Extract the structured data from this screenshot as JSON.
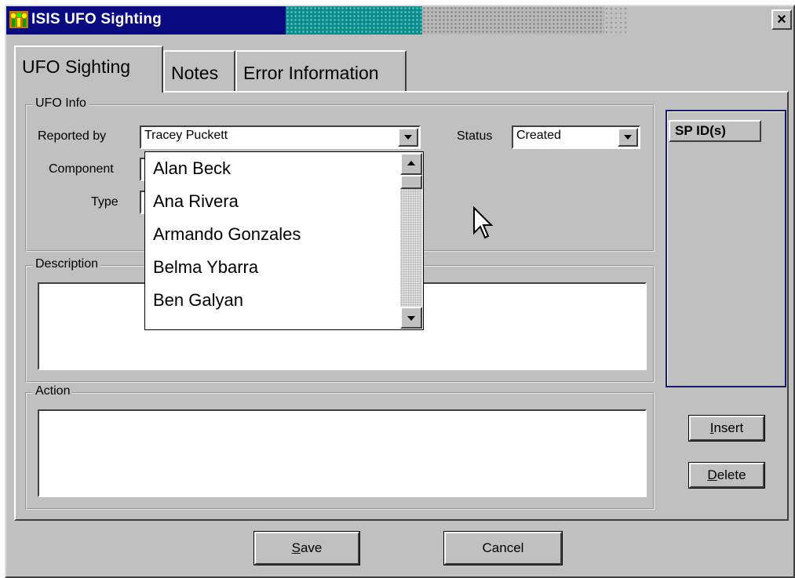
{
  "window": {
    "title": "ISIS UFO Sighting",
    "close_glyph": "×",
    "icon": "app-people-icon"
  },
  "tabs": [
    {
      "label": "UFO Sighting",
      "active": true
    },
    {
      "label": "Notes",
      "active": false
    },
    {
      "label": "Error Information",
      "active": false
    }
  ],
  "ufo_info": {
    "group_label": "UFO Info",
    "reported_by_label": "Reported by",
    "reported_by_value": "Tracey Puckett",
    "component_label": "Component",
    "type_label": "Type",
    "status_label": "Status",
    "status_value": "Created"
  },
  "dropdown_list": {
    "items": [
      "Alan Beck",
      "Ana Rivera",
      "Armando Gonzales",
      "Belma Ybarra",
      "Ben Galyan"
    ]
  },
  "description": {
    "label": "Description"
  },
  "action": {
    "label": "Action"
  },
  "sp_panel": {
    "header": "SP ID(s)"
  },
  "buttons": {
    "insert_prefix": "",
    "insert_mnemonic": "I",
    "insert_rest": "nsert",
    "delete_mnemonic": "D",
    "delete_rest": "elete",
    "save_mnemonic": "S",
    "save_rest": "ave",
    "cancel": "Cancel"
  },
  "colors": {
    "titlebar": "#0a0a80",
    "window_bg": "#c0c0c0",
    "accent_border": "#1a1a6a"
  }
}
